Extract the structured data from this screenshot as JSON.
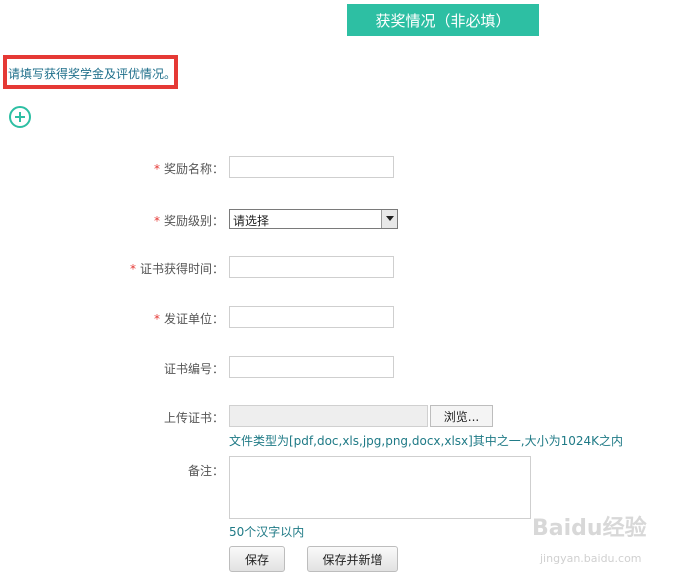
{
  "header": {
    "title": "获奖情况（非必填）"
  },
  "hint": {
    "text": "请填写获得奖学金及评优情况。"
  },
  "form": {
    "award_name": {
      "label": "奖励名称：",
      "required": true,
      "value": ""
    },
    "award_level": {
      "label": "奖励级别：",
      "required": true,
      "selected": "请选择"
    },
    "cert_date": {
      "label": "证书获得时间：",
      "required": true,
      "value": ""
    },
    "issuer": {
      "label": "发证单位：",
      "required": true,
      "value": ""
    },
    "cert_number": {
      "label": "证书编号：",
      "required": false,
      "value": ""
    },
    "upload": {
      "label": "上传证书：",
      "browse_label": "浏览...",
      "note": "文件类型为[pdf,doc,xls,jpg,png,docx,xlsx]其中之一,大小为1024K之内"
    },
    "remark": {
      "label": "备注：",
      "note": "50个汉字以内"
    }
  },
  "buttons": {
    "save": "保存",
    "save_and_add": "保存并新增"
  },
  "required_mark": "*",
  "watermark": {
    "brand": "Baidu经验",
    "url": "jingyan.baidu.com"
  },
  "colors": {
    "accent": "#2dbfa3",
    "highlight": "#e53935",
    "link_text": "#1f7a86"
  }
}
